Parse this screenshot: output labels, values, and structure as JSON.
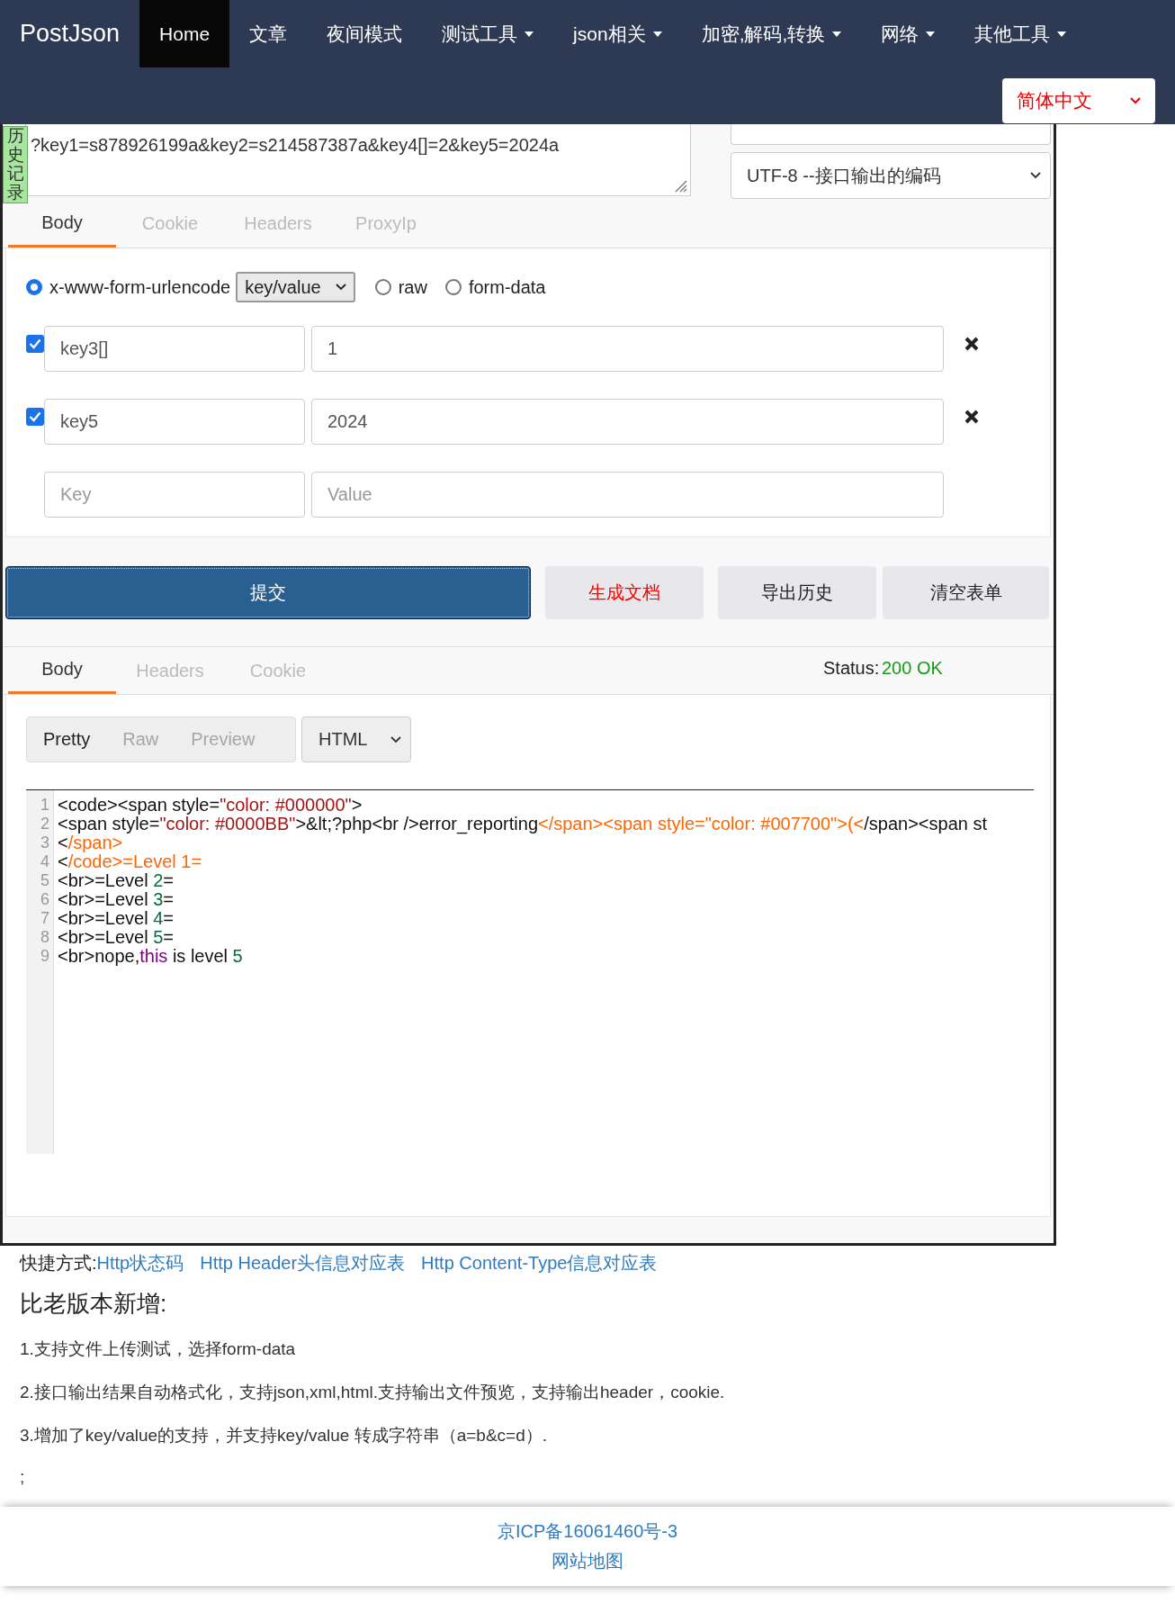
{
  "navbar": {
    "brand": "PostJson",
    "items": [
      {
        "label": "Home",
        "selected": true,
        "has_dropdown": false
      },
      {
        "label": "文章",
        "selected": false,
        "has_dropdown": false
      },
      {
        "label": "夜间模式",
        "selected": false,
        "has_dropdown": false
      },
      {
        "label": "测试工具",
        "selected": false,
        "has_dropdown": true
      },
      {
        "label": "json相关",
        "selected": false,
        "has_dropdown": true
      },
      {
        "label": "加密,解码,转换",
        "selected": false,
        "has_dropdown": true
      },
      {
        "label": "网络",
        "selected": false,
        "has_dropdown": true
      },
      {
        "label": "其他工具",
        "selected": false,
        "has_dropdown": true
      }
    ],
    "language": "简体中文"
  },
  "request": {
    "history_tab": "历史记录",
    "url_value": "?key1=s878926199a&key2=s214587387a&key4[]=2&key5=2024a",
    "encoding": "UTF-8 --接口输出的编码",
    "tabs": [
      {
        "label": "Body",
        "selected": true
      },
      {
        "label": "Cookie",
        "selected": false
      },
      {
        "label": "Headers",
        "selected": false
      },
      {
        "label": "ProxyIp",
        "selected": false
      }
    ],
    "body_types": [
      {
        "label": "x-www-form-urlencode",
        "selected": true,
        "mode": "key/value"
      },
      {
        "label": "raw",
        "selected": false
      },
      {
        "label": "form-data",
        "selected": false
      }
    ],
    "params": [
      {
        "checked": true,
        "key": "key3[]",
        "value": "1"
      },
      {
        "checked": true,
        "key": "key5",
        "value": "2024"
      }
    ],
    "new_param": {
      "key_placeholder": "Key",
      "value_placeholder": "Value"
    },
    "buttons": [
      {
        "label": "提交",
        "kind": "primary"
      },
      {
        "label": "生成文档",
        "kind": "danger"
      },
      {
        "label": "导出历史",
        "kind": "default"
      },
      {
        "label": "清空表单",
        "kind": "default"
      }
    ]
  },
  "response": {
    "tabs": [
      {
        "label": "Body",
        "selected": true
      },
      {
        "label": "Headers",
        "selected": false
      },
      {
        "label": "Cookie",
        "selected": false
      }
    ],
    "status_label": "Status:",
    "status_value": "200 OK",
    "view_modes": [
      {
        "label": "Pretty",
        "selected": true
      },
      {
        "label": "Raw",
        "selected": false
      },
      {
        "label": "Preview",
        "selected": false
      }
    ],
    "format": "HTML",
    "code_lines": [
      {
        "number": "1",
        "segments": [
          {
            "text": "<code><span style=",
            "kind": "plain"
          },
          {
            "text": "\"color: #000000\"",
            "kind": "string"
          },
          {
            "text": ">",
            "kind": "plain"
          }
        ]
      },
      {
        "number": "2",
        "segments": [
          {
            "text": "<span style=",
            "kind": "plain"
          },
          {
            "text": "\"color: #0000BB\"",
            "kind": "string"
          },
          {
            "text": ">&lt;?php<br />error_reporting",
            "kind": "plain"
          },
          {
            "text": "</span><span style=\"color: #007700\">(<",
            "kind": "tag"
          },
          {
            "text": "/span><span st",
            "kind": "plain"
          }
        ]
      },
      {
        "number": "3",
        "segments": [
          {
            "text": "<",
            "kind": "plain"
          },
          {
            "text": "/span>",
            "kind": "tag"
          }
        ]
      },
      {
        "number": "4",
        "segments": [
          {
            "text": "<",
            "kind": "plain"
          },
          {
            "text": "/code>=Level 1=",
            "kind": "tag"
          }
        ]
      },
      {
        "number": "5",
        "segments": [
          {
            "text": "<br>=Level ",
            "kind": "plain"
          },
          {
            "text": "2",
            "kind": "number"
          },
          {
            "text": "=",
            "kind": "plain"
          }
        ]
      },
      {
        "number": "6",
        "segments": [
          {
            "text": "<br>=Level ",
            "kind": "plain"
          },
          {
            "text": "3",
            "kind": "number"
          },
          {
            "text": "=",
            "kind": "plain"
          }
        ]
      },
      {
        "number": "7",
        "segments": [
          {
            "text": "<br>=Level ",
            "kind": "plain"
          },
          {
            "text": "4",
            "kind": "number"
          },
          {
            "text": "=",
            "kind": "plain"
          }
        ]
      },
      {
        "number": "8",
        "segments": [
          {
            "text": "<br>=Level ",
            "kind": "plain"
          },
          {
            "text": "5",
            "kind": "number"
          },
          {
            "text": "=",
            "kind": "plain"
          }
        ]
      },
      {
        "number": "9",
        "segments": [
          {
            "text": "<br>nope,",
            "kind": "plain"
          },
          {
            "text": "this",
            "kind": "keyword"
          },
          {
            "text": " is level ",
            "kind": "plain"
          },
          {
            "text": "5",
            "kind": "number"
          }
        ]
      }
    ]
  },
  "shortcuts": {
    "label": "快捷方式:",
    "links": [
      "Http状态码",
      "Http Header头信息对应表",
      "Http Content-Type信息对应表"
    ]
  },
  "changelog": {
    "title": "比老版本新增:",
    "items": [
      "1.支持文件上传测试，选择form-data",
      "2.接口输出结果自动格式化，支持json,xml,html.支持输出文件预览，支持输出header，cookie.",
      "3.增加了key/value的支持，并支持key/value 转成字符串（a=b&c=d）.",
      ";"
    ]
  },
  "footer": {
    "links": [
      "京ICP备16061460号-3",
      "网站地图"
    ]
  }
}
